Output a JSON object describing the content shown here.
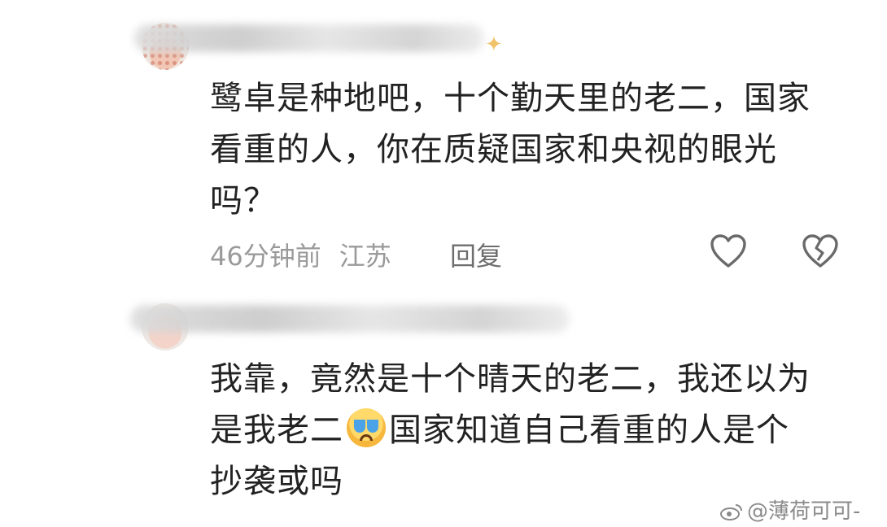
{
  "comments": [
    {
      "lines": [
        "鹭卓是种地吧，十个勤天里的老二，国家",
        "看重的人，你在质疑国家和央视的眼光",
        "吗？"
      ],
      "time": "46分钟前",
      "location": "江苏",
      "reply_label": "回复"
    },
    {
      "line1": "我靠，竟然是十个晴天的老二，我还以为",
      "line2_before": "是我老二",
      "line2_after": "国家知道自己看重的人是个",
      "line3": "抄袭或吗"
    }
  ],
  "watermark": "@薄荷可可-",
  "icons": {
    "like": "heart-outline-icon",
    "dislike": "broken-heart-icon",
    "emoji": "crying-face-emoji",
    "sparkle": "sparkle-icon",
    "weibo": "weibo-logo-icon"
  },
  "colors": {
    "text": "#222222",
    "meta": "#9a9a9a",
    "reply": "#6e6e6e",
    "icon_stroke": "#6a6a6a"
  }
}
